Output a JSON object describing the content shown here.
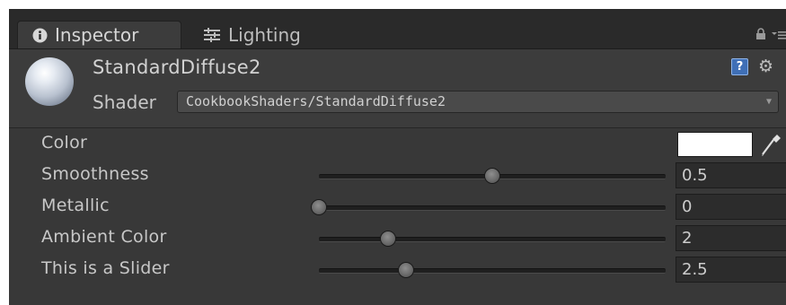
{
  "tabs": [
    {
      "label": "Inspector",
      "icon": "info-icon",
      "active": true
    },
    {
      "label": "Lighting",
      "icon": "lighting-icon",
      "active": false
    }
  ],
  "material": {
    "name": "StandardDiffuse2",
    "shader_label": "Shader",
    "shader_value": "CookbookShaders/StandardDiffuse2"
  },
  "properties": {
    "color": {
      "label": "Color",
      "value_hex": "#ffffff"
    },
    "smoothness": {
      "label": "Smoothness",
      "value": "0.5",
      "slider_fraction": 0.5
    },
    "metallic": {
      "label": "Metallic",
      "value": "0",
      "slider_fraction": 0.0
    },
    "ambient": {
      "label": "Ambient Color",
      "value": "2",
      "slider_fraction": 0.2
    },
    "custom": {
      "label": "This is a Slider",
      "value": "2.5",
      "slider_fraction": 0.25
    }
  },
  "icons": {
    "help": "?",
    "settings": "⚙",
    "lock": "lock-icon",
    "menu": "panel-menu-icon"
  },
  "colors": {
    "panel": "#383838",
    "tabbar": "#2a2a2a",
    "help_blue": "#3f6fb6"
  }
}
